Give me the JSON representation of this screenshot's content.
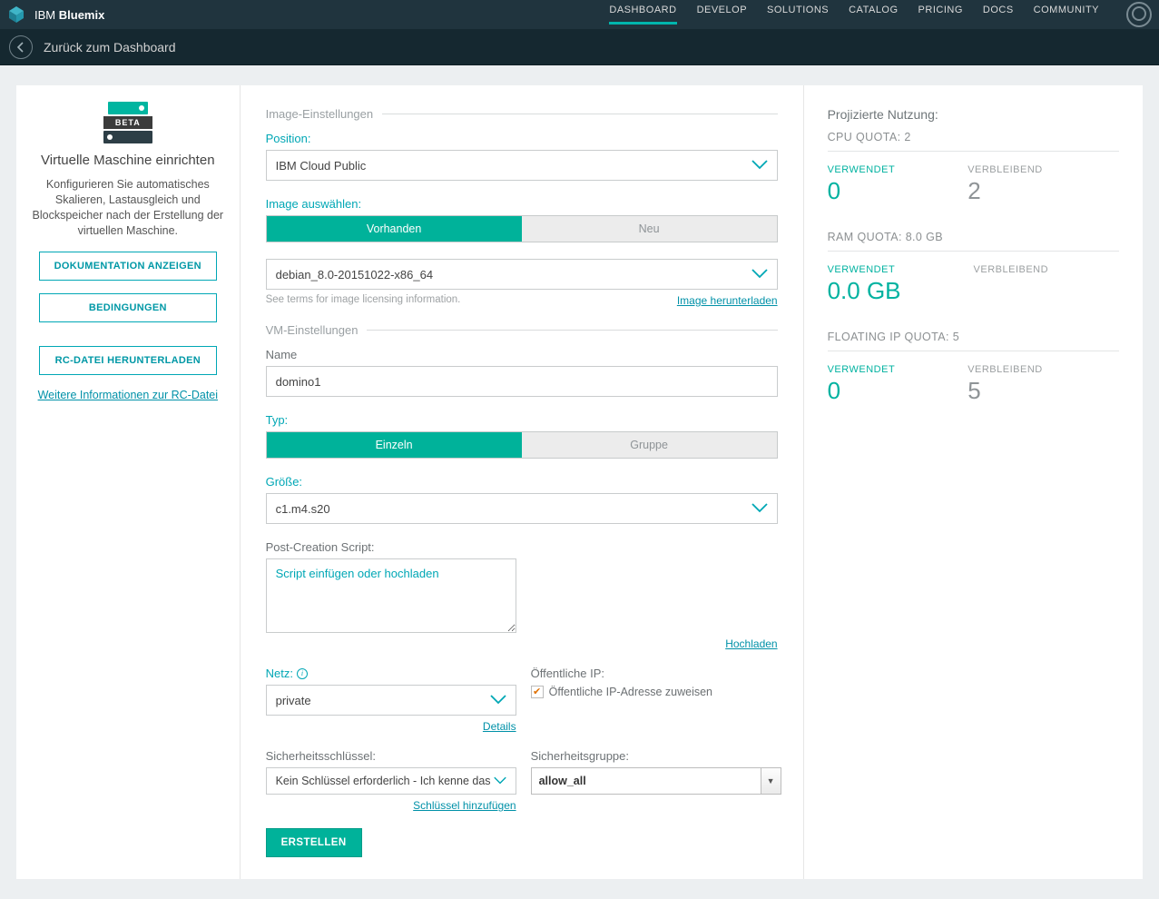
{
  "brand": {
    "prefix": "IBM",
    "name": "Bluemix"
  },
  "topnav": [
    "DASHBOARD",
    "DEVELOP",
    "SOLUTIONS",
    "CATALOG",
    "PRICING",
    "DOCS",
    "COMMUNITY"
  ],
  "subbar": {
    "back_label": "Zurück zum Dashboard"
  },
  "left": {
    "badge": "BETA",
    "title": "Virtuelle Maschine einrichten",
    "desc": "Konfigurieren Sie automatisches Skalieren, Lastausgleich und Blockspeicher nach der Erstellung der virtuellen Maschine.",
    "btn_docs": "DOKUMENTATION ANZEIGEN",
    "btn_terms": "BEDINGUNGEN",
    "btn_rc": "RC-DATEI HERUNTERLADEN",
    "rc_link": "Weitere Informationen zur RC-Datei"
  },
  "image": {
    "section": "Image-Einstellungen",
    "position_label": "Position:",
    "position_value": "IBM Cloud Public",
    "select_label": "Image auswählen:",
    "tab_existing": "Vorhanden",
    "tab_new": "Neu",
    "image_value": "debian_8.0-20151022-x86_64",
    "license_note": "See terms for image licensing information.",
    "download_link": "Image herunterladen"
  },
  "vm": {
    "section": "VM-Einstellungen",
    "name_label": "Name",
    "name_value": "domino1",
    "type_label": "Typ:",
    "type_single": "Einzeln",
    "type_group": "Gruppe",
    "size_label": "Größe:",
    "size_value": "c1.m4.s20",
    "script_label": "Post-Creation Script:",
    "script_placeholder": "Script einfügen oder hochladen",
    "upload_link": "Hochladen",
    "net_label": "Netz:",
    "net_value": "private",
    "details_link": "Details",
    "pubip_label": "Öffentliche IP:",
    "pubip_check": "Öffentliche IP-Adresse zuweisen",
    "key_label": "Sicherheitsschlüssel:",
    "key_value": "Kein Schlüssel erforderlich - Ich kenne das Kennwo",
    "key_add_link": "Schlüssel hinzufügen",
    "group_label": "Sicherheitsgruppe:",
    "group_value": "allow_all",
    "create_btn": "ERSTELLEN"
  },
  "usage": {
    "title": "Projizierte Nutzung:",
    "used": "VERWENDET",
    "remaining": "VERBLEIBEND",
    "cpu": {
      "label": "CPU QUOTA: 2",
      "used": "0",
      "remain": "2"
    },
    "ram": {
      "label": "RAM QUOTA: 8.0 GB",
      "used": "0.0 GB",
      "remain": ""
    },
    "ip": {
      "label": "FLOATING IP QUOTA: 5",
      "used": "0",
      "remain": "5"
    }
  }
}
